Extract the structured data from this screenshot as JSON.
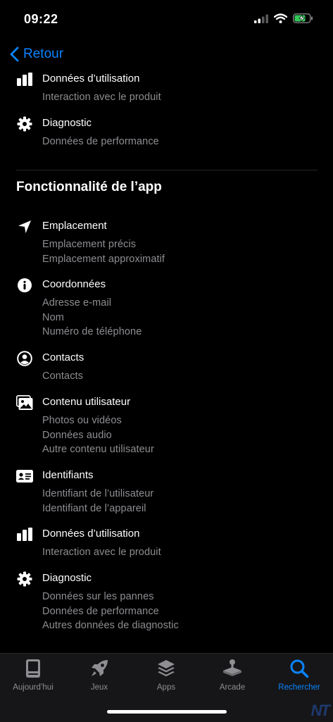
{
  "status": {
    "time": "09:22"
  },
  "nav": {
    "back_label": "Retour"
  },
  "top": [
    {
      "title": "Données d’utilisation",
      "icon": "bar-chart-icon",
      "items": [
        "Interaction avec le produit"
      ]
    },
    {
      "title": "Diagnostic",
      "icon": "gear-icon",
      "items": [
        "Données de performance"
      ]
    }
  ],
  "section": {
    "title": "Fonctionnalité de l’app",
    "categories": [
      {
        "title": "Emplacement",
        "icon": "location-arrow-icon",
        "items": [
          "Emplacement précis",
          "Emplacement approximatif"
        ]
      },
      {
        "title": "Coordonnées",
        "icon": "info-icon",
        "items": [
          "Adresse e-mail",
          "Nom",
          "Numéro de téléphone"
        ]
      },
      {
        "title": "Contacts",
        "icon": "person-circle-icon",
        "items": [
          "Contacts"
        ]
      },
      {
        "title": "Contenu utilisateur",
        "icon": "photos-icon",
        "items": [
          "Photos ou vidéos",
          "Données audio",
          "Autre contenu utilisateur"
        ]
      },
      {
        "title": "Identifiants",
        "icon": "id-card-icon",
        "items": [
          "Identifiant de l’utilisateur",
          "Identifiant de l’appareil"
        ]
      },
      {
        "title": "Données d’utilisation",
        "icon": "bar-chart-icon",
        "items": [
          "Interaction avec le produit"
        ]
      },
      {
        "title": "Diagnostic",
        "icon": "gear-icon",
        "items": [
          "Données sur les pannes",
          "Données de performance",
          "Autres données de diagnostic"
        ]
      }
    ]
  },
  "tabs": [
    {
      "label": "Aujourd’hui",
      "icon": "today-icon",
      "active": false
    },
    {
      "label": "Jeux",
      "icon": "rocket-icon",
      "active": false
    },
    {
      "label": "Apps",
      "icon": "apps-stack-icon",
      "active": false
    },
    {
      "label": "Arcade",
      "icon": "joystick-icon",
      "active": false
    },
    {
      "label": "Rechercher",
      "icon": "search-icon",
      "active": true
    }
  ],
  "watermark": "NT",
  "colors": {
    "accent": "#0a84ff",
    "secondary_text": "#8e8e93",
    "background": "#000000",
    "battery": "#34c759"
  }
}
